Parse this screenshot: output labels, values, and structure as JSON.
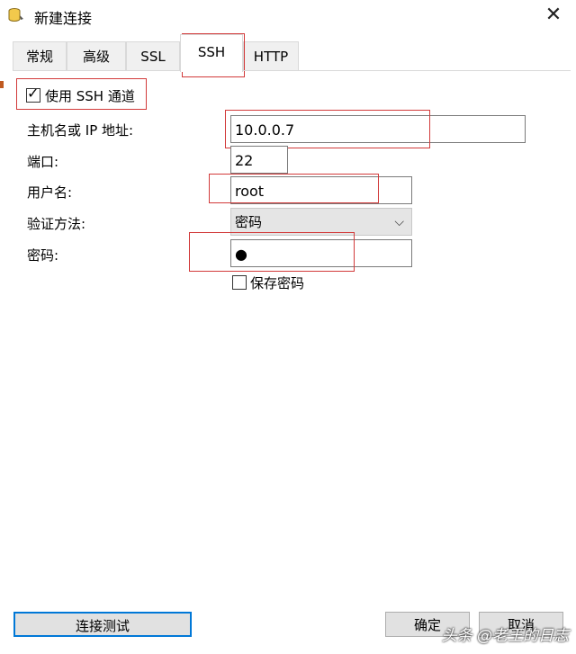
{
  "window": {
    "title": "新建连接",
    "close_glyph": "✕"
  },
  "tabs": [
    {
      "label": "常规"
    },
    {
      "label": "高级"
    },
    {
      "label": "SSL"
    },
    {
      "label": "SSH"
    },
    {
      "label": "HTTP"
    }
  ],
  "ssh": {
    "use_tunnel_label": "使用 SSH 通道",
    "use_tunnel_checked": true,
    "host_label": "主机名或 IP 地址:",
    "host_value": "10.0.0.7",
    "port_label": "端口:",
    "port_value": "22",
    "user_label": "用户名:",
    "user_value": "root",
    "auth_label": "验证方法:",
    "auth_value": "密码",
    "password_label": "密码:",
    "password_value": "●",
    "save_password_label": "保存密码",
    "save_password_checked": false
  },
  "buttons": {
    "test": "连接测试",
    "ok": "确定",
    "cancel": "取消"
  },
  "watermark": "头条 @老王的日志",
  "icons": {
    "app": "database-connection-icon",
    "close": "close-icon",
    "dropdown": "chevron-down-icon"
  },
  "colors": {
    "highlight": "#d23a3a",
    "primary_border": "#0078d7"
  }
}
